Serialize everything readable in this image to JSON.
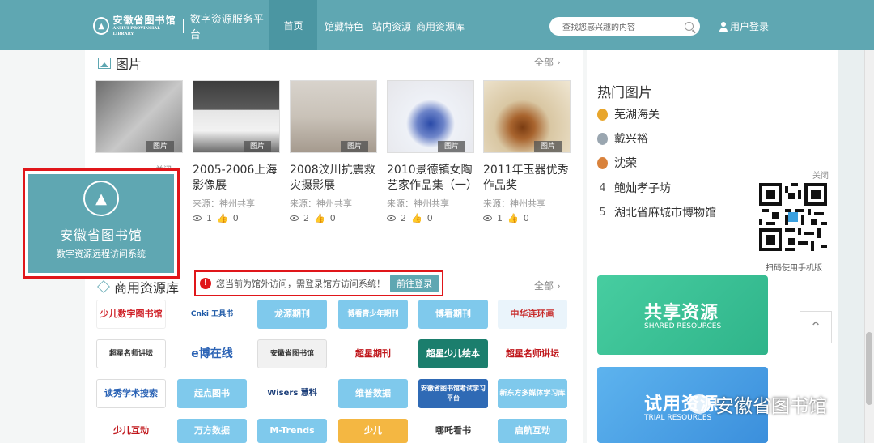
{
  "header": {
    "logo_text": "安徽省图书馆",
    "logo_sub": "ANHUI PROVINCIAL LIBRARY",
    "platform": "数字资源服务平台",
    "nav": [
      "首页",
      "馆藏特色",
      "站内资源",
      "商用资源库"
    ],
    "search_placeholder": "查找您感兴趣的内容",
    "login": "用户登录"
  },
  "pictures": {
    "title": "图片",
    "all": "全部 ›",
    "tag": "图片",
    "close": "关闭",
    "cards": [
      {
        "title": "",
        "source": "",
        "views": "",
        "likes": ""
      },
      {
        "title": "2005-2006上海影像展",
        "source": "来源：神州共享",
        "views": "1",
        "likes": "0"
      },
      {
        "title": "2008汶川抗震救灾摄影展",
        "source": "来源：神州共享",
        "views": "2",
        "likes": "0"
      },
      {
        "title": "2010景德镇女陶艺家作品集（一）",
        "source": "来源：神州共享",
        "views": "2",
        "likes": "0"
      },
      {
        "title": "2011年玉器优秀作品奖",
        "source": "来源：神州共享",
        "views": "1",
        "likes": "0"
      }
    ]
  },
  "remote": {
    "title": "安徽省图书馆",
    "subtitle": "数字资源远程访问系统"
  },
  "commercial": {
    "title": "商用资源库",
    "all": "全部 ›",
    "notice": "您当前为馆外访问，需登录馆方访问系统！",
    "notice_button": "前往登录",
    "tiles": [
      [
        "少儿数字图书馆",
        "Cnki 工具书",
        "龙源期刊",
        "博看青少年期刊",
        "博看期刊",
        "中华连环画"
      ],
      [
        "超星名师讲坛",
        "e博在线",
        "安徽省图书馆",
        "超星期刊",
        "超星少儿绘本",
        "超星名师讲坛"
      ],
      [
        "读秀学术搜索",
        "起点图书",
        "Wisers 慧科",
        "维普数据",
        "安徽省图书馆考试学习平台",
        "新东方多媒体学习库"
      ],
      [
        "少儿互动",
        "万方数据",
        "M-Trends",
        "少儿",
        "哪吒看书",
        "启航互动"
      ]
    ]
  },
  "hot": {
    "title": "热门图片",
    "items": [
      {
        "rank": "1",
        "name": "芜湖海关"
      },
      {
        "rank": "2",
        "name": "戴兴裕"
      },
      {
        "rank": "3",
        "name": "沈荣"
      },
      {
        "rank": "4",
        "name": "鲍灿孝子坊"
      },
      {
        "rank": "5",
        "name": "湖北省麻城市博物馆"
      }
    ],
    "medal_colors": [
      "#e8a62c",
      "#9aa6b0",
      "#d9823c"
    ]
  },
  "qr": {
    "close": "关闭",
    "label": "扫码使用手机版"
  },
  "banners": {
    "shared_title": "共享资源",
    "shared_sub": "SHARED RESOURCES",
    "trial_title": "试用资源",
    "trial_sub": "TRIAL RESOURCES"
  },
  "watermark": "安徽省图书馆",
  "colors": {
    "accent": "#5fa7b2",
    "alert": "#e0161a",
    "shared": "#3fc49a",
    "trial": "#4aa3e6"
  }
}
